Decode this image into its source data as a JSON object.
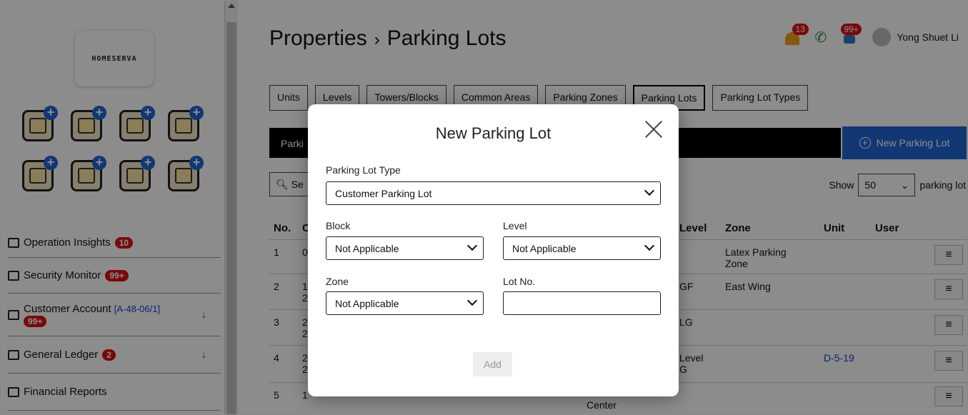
{
  "sidebar": {
    "logo_text": "HOMESERVA",
    "app_icons": [
      "id-card-icon",
      "calendar-icon",
      "finance-building-icon",
      "settings-cluster-icon",
      "key-card-icon",
      "staff-avatar-icon",
      "access-card-icon",
      "login-screen-icon"
    ],
    "nav": [
      {
        "label": "Operation Insights",
        "badge": "10",
        "icon": "bar-chart-icon"
      },
      {
        "label": "Security Monitor",
        "badge": "99+",
        "icon": "monitor-icon"
      },
      {
        "label": "Customer Account",
        "code": "[A-48-06/1]",
        "badge": "99+",
        "icon": "account-icon",
        "arrow": "↓"
      },
      {
        "label": "General Ledger",
        "badge": "2",
        "icon": "ledger-icon",
        "arrow": "↓"
      },
      {
        "label": "Financial Reports",
        "icon": "report-icon"
      }
    ]
  },
  "header": {
    "title_root": "Properties",
    "title_sep": "›",
    "title_page": "Parking Lots",
    "alerts_count": "13",
    "messages_count": "99+",
    "user_name": "Yong Shuet Li"
  },
  "tabs": [
    "Units",
    "Levels",
    "Towers/Blocks",
    "Common Areas",
    "Parking Zones",
    "Parking Lots",
    "Parking Lot Types"
  ],
  "active_tab": "Parking Lots",
  "toolbar": {
    "bar_title": "Parki",
    "new_button": "New Parking Lot",
    "search_placeholder": "Se",
    "show_label": "Show",
    "show_value": "50",
    "show_suffix": "parking lot"
  },
  "table": {
    "headers": {
      "no": "No.",
      "c": "C",
      "level": "Level",
      "zone": "Zone",
      "unit": "Unit",
      "user": "User"
    },
    "rows": [
      {
        "no": "1",
        "c": "0",
        "level": "",
        "zone": "Latex Parking Zone",
        "unit": ""
      },
      {
        "no": "2",
        "c": "1\n2",
        "level": "GF",
        "zone": "East Wing",
        "unit": ""
      },
      {
        "no": "3",
        "c": "2\n2",
        "level": "LG",
        "zone": "",
        "unit": ""
      },
      {
        "no": "4",
        "c": "2\n2",
        "level": "Level\nG",
        "zone": "",
        "unit": "D-5-19"
      },
      {
        "no": "5",
        "c": "1",
        "level": "",
        "zone": "",
        "unit": "",
        "extra": "Center"
      }
    ],
    "menu_glyph": "≡"
  },
  "modal": {
    "title": "New Parking Lot",
    "parking_lot_type_label": "Parking Lot Type",
    "parking_lot_type_value": "Customer Parking Lot",
    "block_label": "Block",
    "block_value": "Not Applicable",
    "level_label": "Level",
    "level_value": "Not Applicable",
    "zone_label": "Zone",
    "zone_value": "Not Applicable",
    "lot_no_label": "Lot No.",
    "lot_no_value": "",
    "add_button": "Add"
  },
  "colors": {
    "primary": "#1f64d6",
    "badge_red": "#d11111",
    "overlay": "rgba(0,0,0,0.45)"
  }
}
